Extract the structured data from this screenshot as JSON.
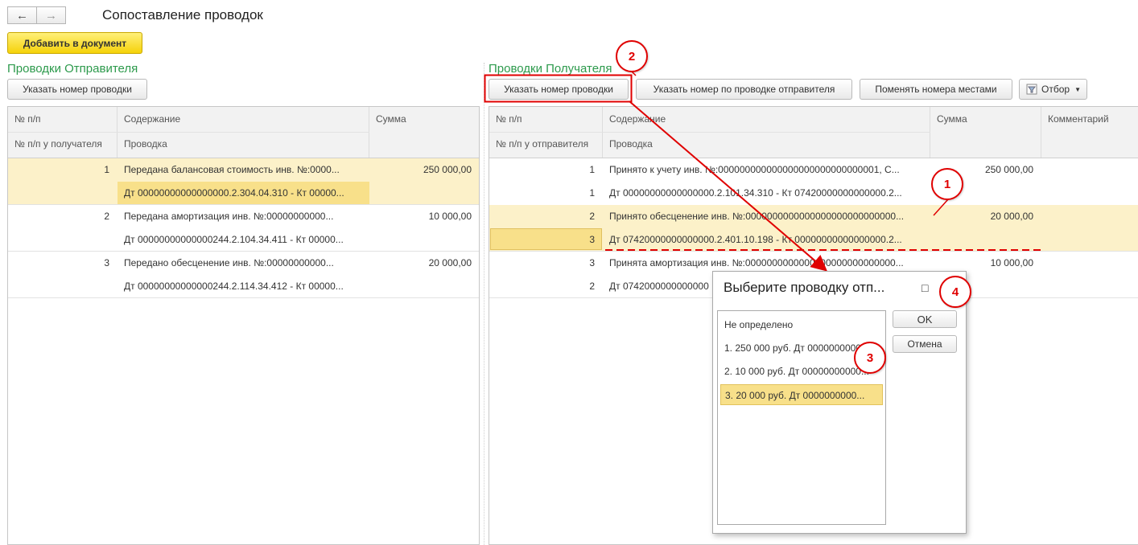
{
  "header": {
    "back_icon": "←",
    "forward_icon": "→",
    "title": "Сопоставление проводок"
  },
  "toolbar": {
    "add_button": "Добавить в документ"
  },
  "sender": {
    "title": "Проводки Отправителя",
    "set_number_button": "Указать номер проводки",
    "columns": {
      "num": "№ п/п",
      "content": "Содержание",
      "sum": "Сумма",
      "num_recipient": "№ п/п у получателя",
      "entry": "Проводка"
    },
    "rows": [
      {
        "num": "1",
        "content": "Передана балансовая стоимость инв. №:0000...",
        "sum": "250 000,00",
        "entry": "Дт 00000000000000000.2.304.04.310 - Кт 00000..."
      },
      {
        "num": "2",
        "content": "Передана амортизация инв. №:00000000000...",
        "sum": "10 000,00",
        "entry": "Дт 00000000000000244.2.104.34.411 - Кт 00000..."
      },
      {
        "num": "3",
        "content": "Передано обесценение инв. №:00000000000...",
        "sum": "20 000,00",
        "entry": "Дт 00000000000000244.2.114.34.412 - Кт 00000..."
      }
    ]
  },
  "recipient": {
    "title": "Проводки Получателя",
    "set_number_button": "Указать номер проводки",
    "set_by_sender_button": "Указать номер по проводке отправителя",
    "swap_button": "Поменять номера местами",
    "filter_button": "Отбор",
    "columns": {
      "num": "№ п/п",
      "content": "Содержание",
      "sum": "Сумма",
      "comment": "Комментарий",
      "num_sender": "№ п/п у отправителя",
      "entry": "Проводка"
    },
    "rows": [
      {
        "num": "1",
        "content": "Принято к учету инв. №:000000000000000000000000000001, С...",
        "sum": "250 000,00",
        "num_sender": "1",
        "entry": "Дт 00000000000000000.2.101.34.310 - Кт 07420000000000000.2..."
      },
      {
        "num": "2",
        "content": "Принято обесценение инв. №:0000000000000000000000000000...",
        "sum": "20 000,00",
        "num_sender": "3",
        "entry": "Дт 07420000000000000.2.401.10.198 - Кт 00000000000000000.2..."
      },
      {
        "num": "3",
        "content": "Принята амортизация инв. №:0000000000000000000000000000...",
        "sum": "10 000,00",
        "num_sender": "2",
        "entry": "Дт 0742000000000000"
      }
    ]
  },
  "dialog": {
    "title": "Выберите проводку отп...",
    "maximize_icon": "□",
    "items": [
      "Не определено",
      "1. 250 000 руб. Дт 0000000000...",
      "2. 10 000 руб. Дт 00000000000...",
      "3. 20 000 руб. Дт 0000000000..."
    ],
    "ok_button": "OK",
    "cancel_button": "Отмена"
  },
  "annotations": {
    "badge1": "1",
    "badge2": "2",
    "badge3": "3",
    "badge4": "4",
    "color": "#e00000"
  }
}
